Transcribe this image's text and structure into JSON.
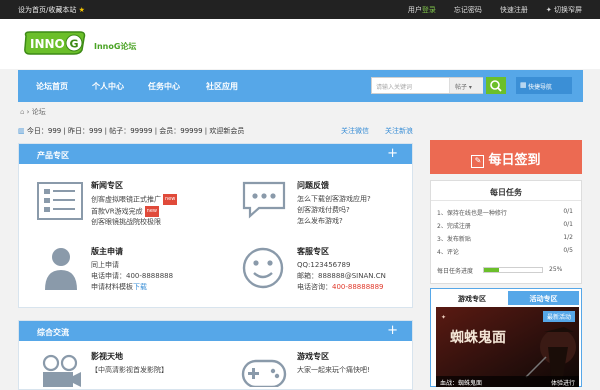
{
  "topbar": {
    "left_text": "设为首页/收藏本站",
    "user_center": "用户",
    "login": "登录",
    "forgot": "忘记密码",
    "register": "快速注册",
    "switch": "切换窄屏"
  },
  "header": {
    "logo_text": "INNO",
    "logo_badge": "G",
    "site_name": "InnoG论坛"
  },
  "nav": {
    "items": [
      "论坛首页",
      "个人中心",
      "任务中心",
      "社区应用"
    ],
    "search_placeholder": "请输入关键词",
    "search_select": "帖子",
    "quick_nav": "快捷导航"
  },
  "breadcrumb": {
    "label": "论坛"
  },
  "stats": {
    "text": "今日：999 | 昨日：999 | 帖子：99999 | 会员：99999 | 欢迎新会员",
    "link1": "关注微信",
    "link2": "关注新浪"
  },
  "product": {
    "title": "产品专区",
    "news": {
      "title": "新闻专区",
      "lines": [
        "创客虚拟眼镜正式推广",
        "首款VR游戏完成",
        "创客眼镜挑战院校极限"
      ],
      "badge": "new"
    },
    "faq": {
      "title": "问题反馈",
      "lines": [
        "怎么下载创客游戏应用?",
        "创客游戏付费吗?",
        "怎么发布游戏?"
      ]
    },
    "mod": {
      "title": "版主申请",
      "lines": [
        "同上申请",
        "电话申请：400-8888888"
      ],
      "last_prefix": "申请材料模板",
      "last_link": "下载"
    },
    "service": {
      "title": "客服专区",
      "qq": "QQ:123456789",
      "mail": "邮箱：888888@SINAN.CN",
      "phone_prefix": "电话咨询：",
      "phone": "400-88888889"
    }
  },
  "general": {
    "title": "综合交流",
    "video": {
      "title": "影视天地",
      "line": "【中高清影视首发影院】"
    },
    "game": {
      "title": "游戏专区",
      "line": "大家一起来玩个痛快吧!"
    }
  },
  "side": {
    "checkin": "每日签到",
    "task_title": "每日任务",
    "tasks": [
      {
        "name": "1、保持在线也是一种修行",
        "count": "0/1"
      },
      {
        "name": "2、完成注册",
        "count": "0/1"
      },
      {
        "name": "3、发布新贴",
        "count": "1/2"
      },
      {
        "name": "4、评论",
        "count": "0/5"
      }
    ],
    "progress_label": "每日任务进度",
    "progress_value": 0.25,
    "progress_text": "25%",
    "tab_active": "游戏专区",
    "tab_other": "活动专区",
    "game_badge": "最新活动",
    "game_title": "蜘蛛鬼面",
    "game_caption": "血战：蜘蛛鬼面",
    "game_sub": "体验进行"
  },
  "colors": {
    "nav_blue": "#56a7e8",
    "green": "#6bbf2a",
    "checkin": "#ec6a52",
    "red": "#e0392b"
  }
}
